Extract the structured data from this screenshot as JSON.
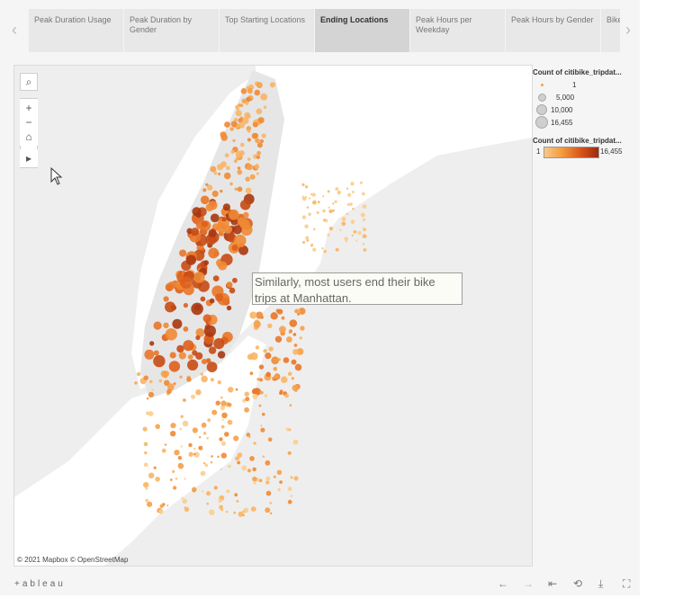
{
  "tabs": [
    {
      "label": "Peak Duration Usage"
    },
    {
      "label": "Peak Duration by Gender"
    },
    {
      "label": "Top Starting Locations"
    },
    {
      "label": "Ending Locations"
    },
    {
      "label": "Peak Hours per Weekday"
    },
    {
      "label": "Peak Hours by Gender"
    },
    {
      "label": "Bike"
    }
  ],
  "active_tab": "Ending Locations",
  "nav": {
    "prev": "‹",
    "next": "›"
  },
  "map": {
    "annotation": "Similarly, most users end their bike trips at Manhattan.",
    "attribution": "© 2021 Mapbox  © OpenStreetMap",
    "controls": {
      "search": "⌕",
      "zoom_in": "+",
      "zoom_out": "−",
      "home": "⌂",
      "expand": "▸"
    }
  },
  "legend_size": {
    "title": "Count of citibike_tripdat...",
    "entries": [
      {
        "label": "1"
      },
      {
        "label": "5,000"
      },
      {
        "label": "10,000"
      },
      {
        "label": "16,455"
      }
    ]
  },
  "legend_color": {
    "title": "Count of citibike_tripdat...",
    "min_label": "1",
    "max_label": "16,455",
    "color_low": "#f8c98a",
    "color_high": "#9a2a10"
  },
  "toolbar": {
    "logo": "+ableau",
    "undo": "←",
    "redo": "→",
    "revert": "⇤",
    "share": "⟲",
    "download": "⤓",
    "fullscreen": "⛶"
  }
}
